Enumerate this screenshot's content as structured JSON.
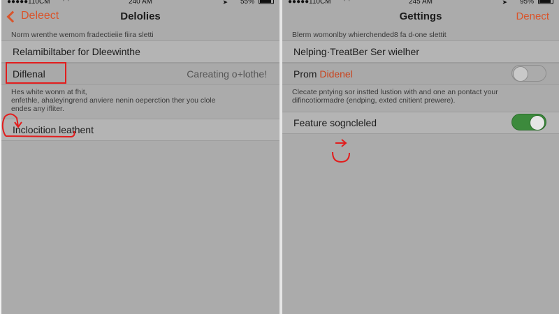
{
  "left": {
    "status": {
      "carrier": "110CM",
      "time": "240 AM",
      "battery": "55%"
    },
    "nav": {
      "back_label": "Deleect",
      "title": "Delolies"
    },
    "note_top": "Norm wrenthe wemom fradectieiie fiira sletti",
    "row1": {
      "label": "Relamibiltaber for Dleewinthe"
    },
    "row2": {
      "label": "Diflenal",
      "value": "Careating o+lothe!"
    },
    "note_mid": "Hes white wonm at fhit,\nenfethle, ahaleyingrend anviere nenin oeperction ther you clole\nendes any ifliter.",
    "row3": {
      "label": "Inclocition leathent"
    }
  },
  "right": {
    "status": {
      "carrier": "110CM",
      "time": "245 AM",
      "battery": "95%"
    },
    "nav": {
      "title": "Gettings",
      "action_label": "Denect"
    },
    "note_top": "Blerm womonlby whierchended8 fa d-one slettit",
    "row1": {
      "label": "Nelping·TreatBer Ser wielher"
    },
    "row2": {
      "label_plain": "Prom",
      "label_accent": "Didenel",
      "toggle_on": false
    },
    "note_mid": "Clecate pntying sor instted lustion with and one an pontact your\ndifincotiormadre (endping, exted cnitient prewere).",
    "row3": {
      "label": "Feature sogncleled",
      "toggle_on": true
    }
  },
  "colors": {
    "accent": "#d9542b",
    "annotation": "#e21d1d",
    "toggle_on": "#3c8a3c",
    "screen_bg": "#ababab"
  }
}
